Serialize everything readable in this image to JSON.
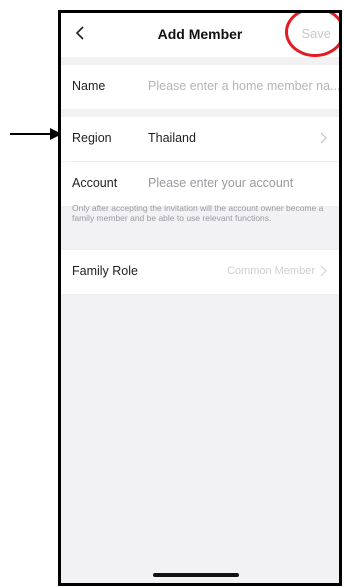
{
  "header": {
    "title": "Add Member",
    "save_label": "Save"
  },
  "form": {
    "name": {
      "label": "Name",
      "placeholder": "Please enter a home member na..."
    },
    "region": {
      "label": "Region",
      "value": "Thailand"
    },
    "account": {
      "label": "Account",
      "placeholder": "Please enter your account"
    },
    "hint": "Only after accepting the invitation will the account owner become a family member and be able to use relevant functions.",
    "family_role": {
      "label": "Family Role",
      "value": "Common Member"
    }
  },
  "annotations": {
    "highlight_color": "#e31b23",
    "arrow_color": "#000000"
  }
}
